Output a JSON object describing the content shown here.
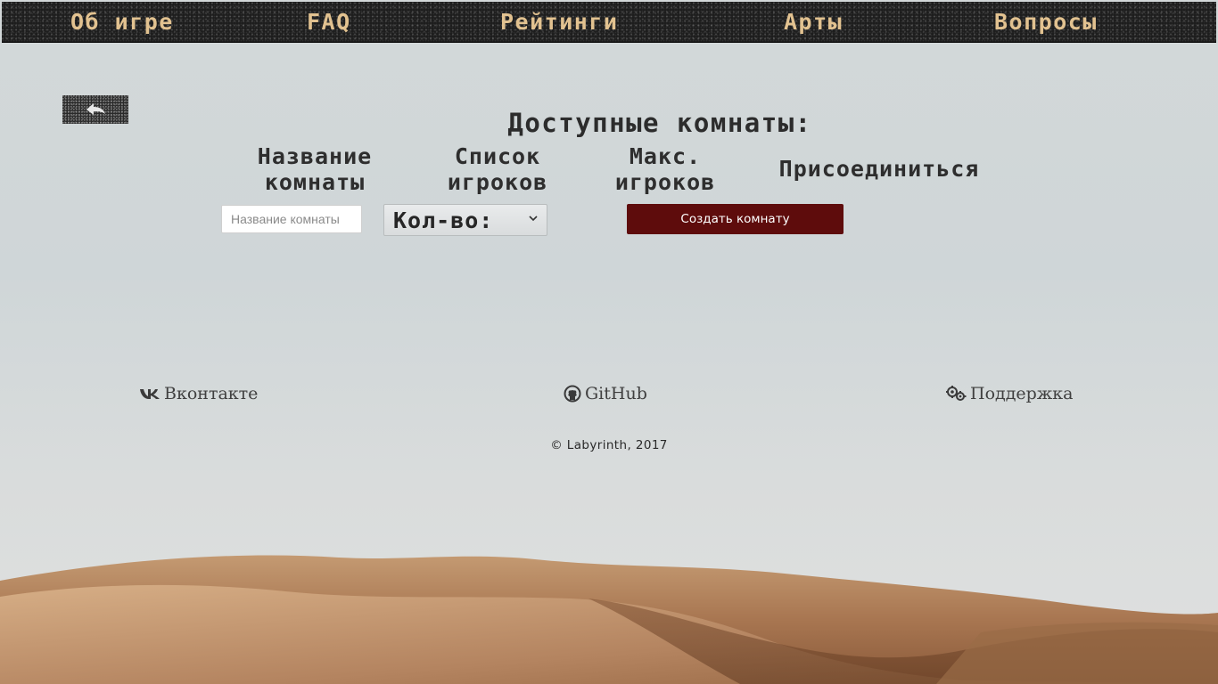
{
  "nav": {
    "items": [
      {
        "label": "Об игре"
      },
      {
        "label": "FAQ"
      },
      {
        "label": "Рейтинги"
      },
      {
        "label": "Арты"
      },
      {
        "label": "Вопросы"
      }
    ]
  },
  "main": {
    "title": "Доступные комнаты:",
    "columns": [
      {
        "line1": "Название",
        "line2": "комнаты"
      },
      {
        "line1": "Список",
        "line2": "игроков"
      },
      {
        "line1": "Макс.",
        "line2": "игроков"
      },
      {
        "line1": "Присоединиться",
        "line2": ""
      }
    ],
    "room_name_placeholder": "Название комнаты",
    "room_name_value": "",
    "player_count_selected": "Кол-во:",
    "create_button": "Создать комнату"
  },
  "footer": {
    "links": [
      {
        "label": "Вконтакте",
        "icon": "vk-icon"
      },
      {
        "label": "GitHub",
        "icon": "github-icon"
      },
      {
        "label": "Поддержка",
        "icon": "support-icon"
      }
    ],
    "copyright": "© Labyrinth, 2017"
  },
  "colors": {
    "nav_bg": "#1c1c1c",
    "nav_text": "#e2c290",
    "create_button_bg": "#5e0c0c",
    "page_bg": "#d3d8d9",
    "sand": "#b88a60"
  }
}
